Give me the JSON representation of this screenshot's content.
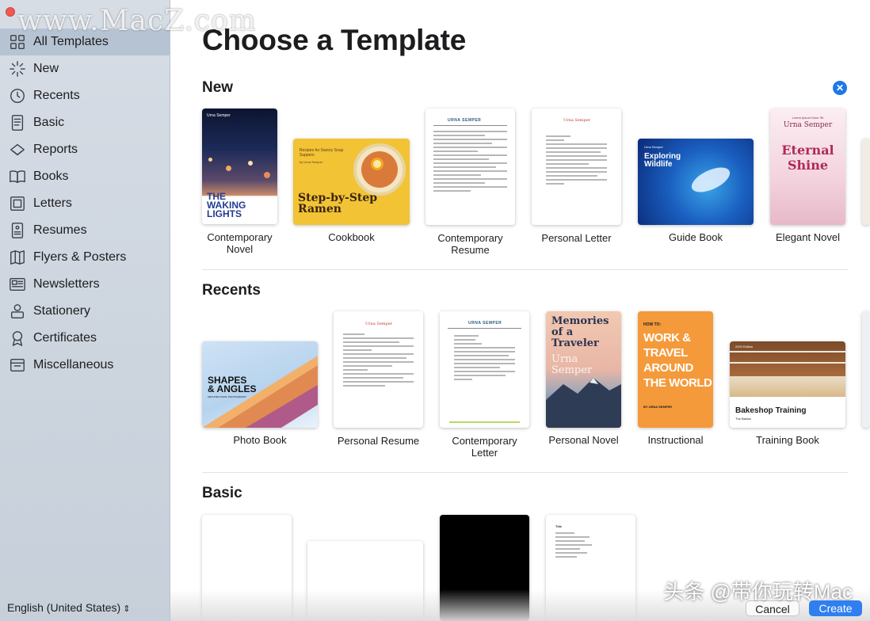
{
  "sidebar": {
    "items": [
      {
        "label": "All Templates",
        "icon": "grid-icon"
      },
      {
        "label": "New",
        "icon": "sparkle-icon"
      },
      {
        "label": "Recents",
        "icon": "clock-icon"
      },
      {
        "label": "Basic",
        "icon": "document-icon"
      },
      {
        "label": "Reports",
        "icon": "report-icon"
      },
      {
        "label": "Books",
        "icon": "book-icon"
      },
      {
        "label": "Letters",
        "icon": "letter-icon"
      },
      {
        "label": "Resumes",
        "icon": "resume-icon"
      },
      {
        "label": "Flyers & Posters",
        "icon": "map-icon"
      },
      {
        "label": "Newsletters",
        "icon": "newsletter-icon"
      },
      {
        "label": "Stationery",
        "icon": "stationery-icon"
      },
      {
        "label": "Certificates",
        "icon": "ribbon-icon"
      },
      {
        "label": "Miscellaneous",
        "icon": "tray-icon"
      }
    ],
    "selected_index": 0,
    "language": "English (United States)"
  },
  "main": {
    "title": "Choose a Template",
    "sections": {
      "new": {
        "heading": "New",
        "tiles": [
          {
            "label_1": "Contemporary",
            "label_2": "Novel"
          },
          {
            "label_1": "Cookbook",
            "label_2": ""
          },
          {
            "label_1": "Contemporary",
            "label_2": "Resume"
          },
          {
            "label_1": "Personal Letter",
            "label_2": ""
          },
          {
            "label_1": "Guide Book",
            "label_2": ""
          },
          {
            "label_1": "Elegant Novel",
            "label_2": ""
          }
        ]
      },
      "recents": {
        "heading": "Recents",
        "tiles": [
          {
            "label_1": "Photo Book",
            "label_2": ""
          },
          {
            "label_1": "Personal Resume",
            "label_2": ""
          },
          {
            "label_1": "Contemporary",
            "label_2": "Letter"
          },
          {
            "label_1": "Personal Novel",
            "label_2": ""
          },
          {
            "label_1": "Instructional",
            "label_2": ""
          },
          {
            "label_1": "Training Book",
            "label_2": ""
          }
        ]
      },
      "basic": {
        "heading": "Basic"
      }
    }
  },
  "covers": {
    "novel_author": "Urna Semper",
    "novel_title_1": "THE",
    "novel_title_2": "WAKING",
    "novel_title_3": "LIGHTS",
    "cookbook_small": "Recipes for Savory Soup Suppers",
    "cookbook_author": "by Urna Semper",
    "cookbook_title_1": "Step-by-Step",
    "cookbook_title_2": "Ramen",
    "resume_name": "URNA SEMPER",
    "letter_name": "Urna Semper",
    "guide_small": "Urna Semper",
    "guide_title_1": "Exploring",
    "guide_title_2": "Wildlife",
    "elegant_small": "Lorem Ipsum Dolor Sit",
    "elegant_author": "Urna Semper",
    "elegant_title_1": "Eternal",
    "elegant_title_2": "Shine",
    "photobook_title_1": "SHAPES",
    "photobook_title_2": "& ANGLES",
    "photobook_sub": "ARCHITECTURAL PHOTOGRAPHY",
    "presume_name": "Urna Semper",
    "cletter_name": "URNA SEMPER",
    "pnovel_title_1": "Memories",
    "pnovel_title_2": "of a",
    "pnovel_title_3": "Traveler",
    "pnovel_author_1": "Urna",
    "pnovel_author_2": "Semper",
    "instr_title_1": "HOW TO:",
    "instr_title_2": "WORK &",
    "instr_title_3": "TRAVEL",
    "instr_title_4": "AROUND",
    "instr_title_5": "THE WORLD",
    "instr_author": "BY URNA SEMPER",
    "training_edition": "2020 Edition",
    "training_title": "Bakeshop Training",
    "training_sub": "The Basics",
    "notes_title": "Title"
  },
  "buttons": {
    "cancel": "Cancel",
    "create": "Create"
  },
  "watermarks": {
    "top": "www.MacZ.com",
    "bottom": "头条 @带你玩转Mac"
  },
  "colors": {
    "accent": "#2f7ff0",
    "sidebar_selected": "#b6c3d3"
  }
}
